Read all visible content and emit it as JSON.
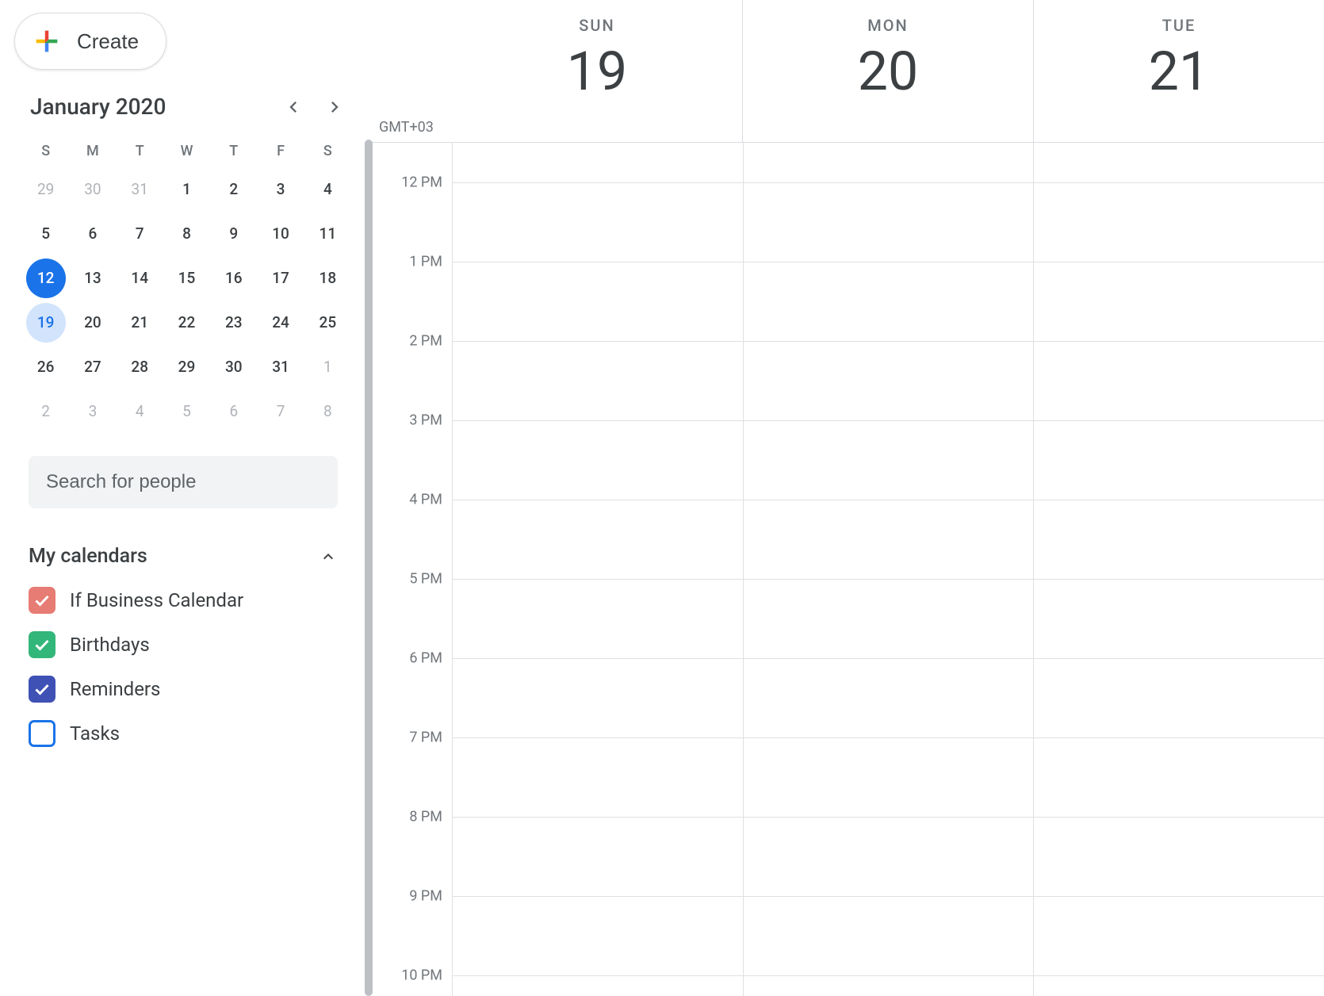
{
  "create_label": "Create",
  "minical": {
    "title": "January 2020",
    "dow": [
      "S",
      "M",
      "T",
      "W",
      "T",
      "F",
      "S"
    ],
    "days": [
      {
        "n": "29",
        "muted": true
      },
      {
        "n": "30",
        "muted": true
      },
      {
        "n": "31",
        "muted": true
      },
      {
        "n": "1"
      },
      {
        "n": "2"
      },
      {
        "n": "3"
      },
      {
        "n": "4"
      },
      {
        "n": "5"
      },
      {
        "n": "6"
      },
      {
        "n": "7"
      },
      {
        "n": "8"
      },
      {
        "n": "9"
      },
      {
        "n": "10"
      },
      {
        "n": "11"
      },
      {
        "n": "12",
        "today": true
      },
      {
        "n": "13"
      },
      {
        "n": "14"
      },
      {
        "n": "15"
      },
      {
        "n": "16"
      },
      {
        "n": "17"
      },
      {
        "n": "18"
      },
      {
        "n": "19",
        "selected": true
      },
      {
        "n": "20"
      },
      {
        "n": "21"
      },
      {
        "n": "22"
      },
      {
        "n": "23"
      },
      {
        "n": "24"
      },
      {
        "n": "25"
      },
      {
        "n": "26"
      },
      {
        "n": "27"
      },
      {
        "n": "28"
      },
      {
        "n": "29"
      },
      {
        "n": "30"
      },
      {
        "n": "31"
      },
      {
        "n": "1",
        "muted": true
      },
      {
        "n": "2",
        "muted": true
      },
      {
        "n": "3",
        "muted": true
      },
      {
        "n": "4",
        "muted": true
      },
      {
        "n": "5",
        "muted": true
      },
      {
        "n": "6",
        "muted": true
      },
      {
        "n": "7",
        "muted": true
      },
      {
        "n": "8",
        "muted": true
      }
    ]
  },
  "search_placeholder": "Search for people",
  "my_calendars_label": "My calendars",
  "calendars": [
    {
      "label": "If Business Calendar",
      "color": "#e67c73",
      "checked": true
    },
    {
      "label": "Birthdays",
      "color": "#33b679",
      "checked": true
    },
    {
      "label": "Reminders",
      "color": "#3f51b5",
      "checked": true
    },
    {
      "label": "Tasks",
      "color": "#1a73e8",
      "checked": false
    }
  ],
  "timezone": "GMT+03",
  "day_columns": [
    {
      "dow": "SUN",
      "date": "19"
    },
    {
      "dow": "MON",
      "date": "20"
    },
    {
      "dow": "TUE",
      "date": "21"
    }
  ],
  "hours": [
    "12 PM",
    "1 PM",
    "2 PM",
    "3 PM",
    "4 PM",
    "5 PM",
    "6 PM",
    "7 PM",
    "8 PM",
    "9 PM",
    "10 PM"
  ]
}
